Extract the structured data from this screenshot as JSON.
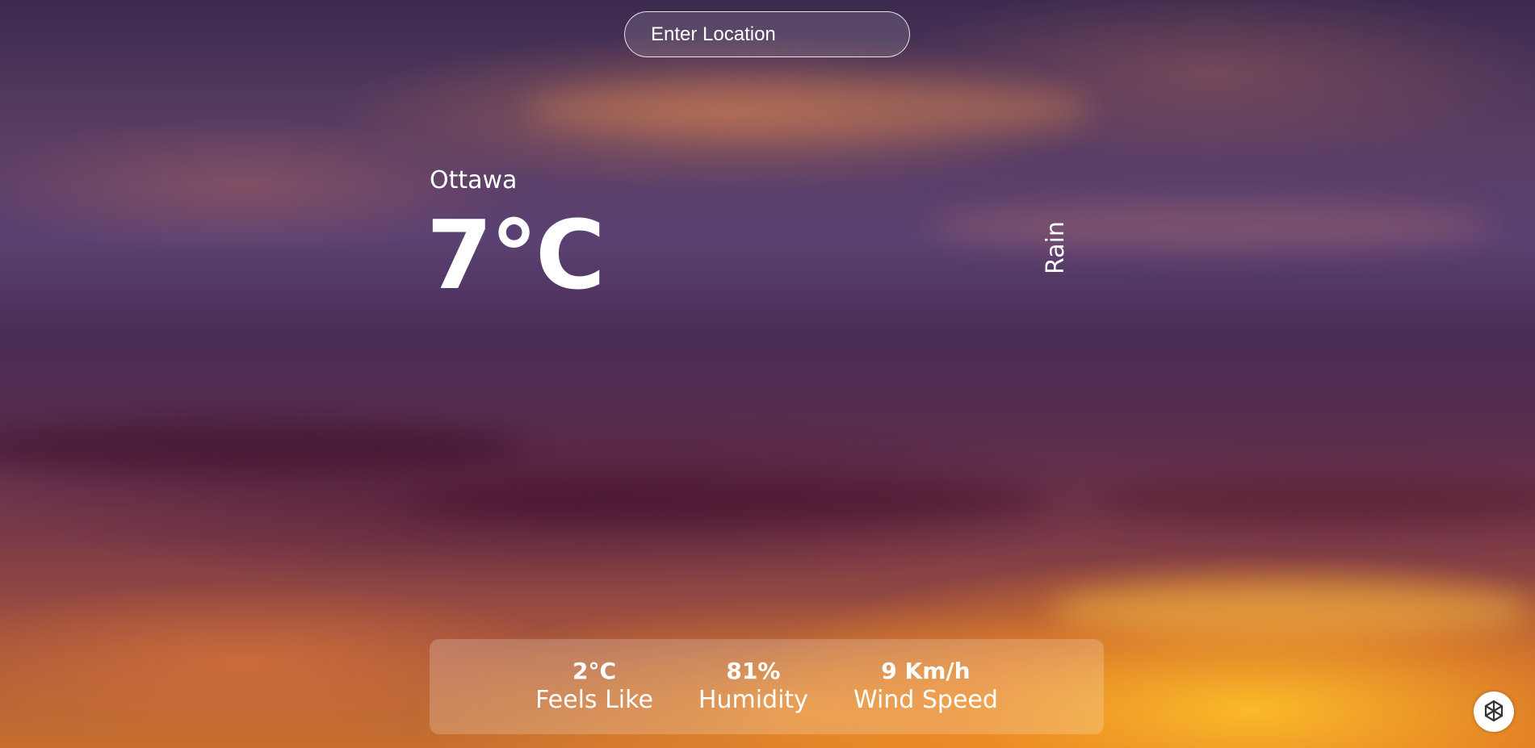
{
  "search": {
    "placeholder": "Enter Location"
  },
  "weather": {
    "location": "Ottawa",
    "temperature": "7°C",
    "condition": "Rain"
  },
  "stats": [
    {
      "value": "2°C",
      "label": "Feels Like"
    },
    {
      "value": "81%",
      "label": "Humidity"
    },
    {
      "value": "9 Km/h",
      "label": "Wind Speed"
    }
  ],
  "icons": {
    "assistant": "openai-logo-icon"
  },
  "colors": {
    "text": "#ffffff",
    "panel": "rgba(255,255,255,0.2)"
  }
}
